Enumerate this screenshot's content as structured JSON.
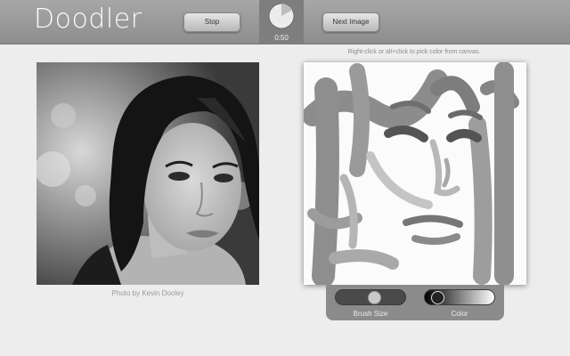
{
  "app": {
    "title": "Doodler"
  },
  "toolbar": {
    "stop_label": "Stop",
    "next_label": "Next Image",
    "timer_text": "0:50",
    "timer_remaining_fraction": 0.83
  },
  "hint": "Right-click or alt+click to pick color from canvas.",
  "photo": {
    "caption": "Photo by Kevin Dooley",
    "icon": "portrait-photo"
  },
  "tools": {
    "brush_label": "Brush Size",
    "color_label": "Color",
    "brush_size_fraction": 0.55,
    "color_value_fraction": 0.1
  },
  "colors": {
    "topbar": "#999999",
    "background": "#ededed",
    "canvas": "#fbfbfb",
    "panel": "#8b8b8b"
  }
}
